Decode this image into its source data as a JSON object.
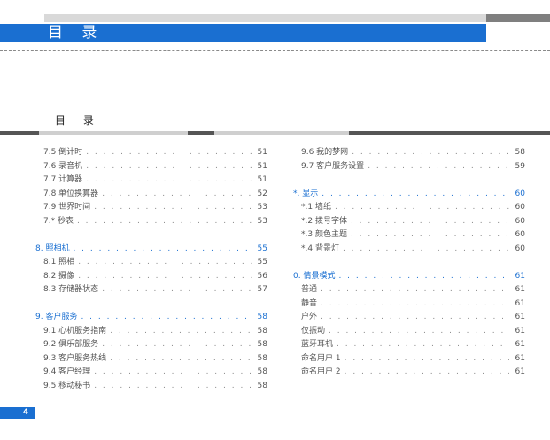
{
  "header": {
    "title": "目 录"
  },
  "section_title": "目 录",
  "page_number": "4",
  "toc_left": [
    {
      "type": "item",
      "text": "7.5 倒计时",
      "page": "51"
    },
    {
      "type": "item",
      "text": "7.6 录音机",
      "page": "51"
    },
    {
      "type": "item",
      "text": "7.7 计算器",
      "page": "51"
    },
    {
      "type": "item",
      "text": "7.8 单位换算器",
      "page": "52"
    },
    {
      "type": "item",
      "text": "7.9 世界时间",
      "page": "53"
    },
    {
      "type": "item",
      "text": "7.* 秒表",
      "page": "53"
    },
    {
      "type": "spacer"
    },
    {
      "type": "cat",
      "text": "8. 照相机",
      "page": "55"
    },
    {
      "type": "item",
      "text": "8.1 照相",
      "page": "55"
    },
    {
      "type": "item",
      "text": "8.2 摄像",
      "page": "56"
    },
    {
      "type": "item",
      "text": "8.3 存储器状态",
      "page": "57"
    },
    {
      "type": "spacer"
    },
    {
      "type": "cat",
      "text": "9. 客户服务",
      "page": "58"
    },
    {
      "type": "item",
      "text": "9.1 心机服务指南",
      "page": "58"
    },
    {
      "type": "item",
      "text": "9.2 俱乐部服务",
      "page": "58"
    },
    {
      "type": "item",
      "text": "9.3 客户服务热线",
      "page": "58"
    },
    {
      "type": "item",
      "text": "9.4 客户经理",
      "page": "58"
    },
    {
      "type": "item",
      "text": "9.5 移动秘书",
      "page": "58"
    }
  ],
  "toc_right": [
    {
      "type": "item",
      "text": "9.6 我的梦网",
      "page": "58"
    },
    {
      "type": "item",
      "text": "9.7 客户服务设置",
      "page": "59"
    },
    {
      "type": "spacer"
    },
    {
      "type": "cat",
      "text": "*. 显示",
      "page": "60"
    },
    {
      "type": "item",
      "text": "*.1 墙纸",
      "page": "60"
    },
    {
      "type": "item",
      "text": "*.2 拨号字体",
      "page": "60"
    },
    {
      "type": "item",
      "text": "*.3 颜色主题",
      "page": "60"
    },
    {
      "type": "item",
      "text": "*.4 背景灯",
      "page": "60"
    },
    {
      "type": "spacer"
    },
    {
      "type": "cat",
      "text": "0. 情景模式",
      "page": "61"
    },
    {
      "type": "item",
      "text": "普通",
      "page": "61"
    },
    {
      "type": "item",
      "text": "静音",
      "page": "61"
    },
    {
      "type": "item",
      "text": "户外",
      "page": "61"
    },
    {
      "type": "item",
      "text": "仅振动",
      "page": "61"
    },
    {
      "type": "item",
      "text": "蓝牙耳机",
      "page": "61"
    },
    {
      "type": "item",
      "text": "命名用户 1",
      "page": "61"
    },
    {
      "type": "item",
      "text": "命名用户 2",
      "page": "61"
    }
  ]
}
